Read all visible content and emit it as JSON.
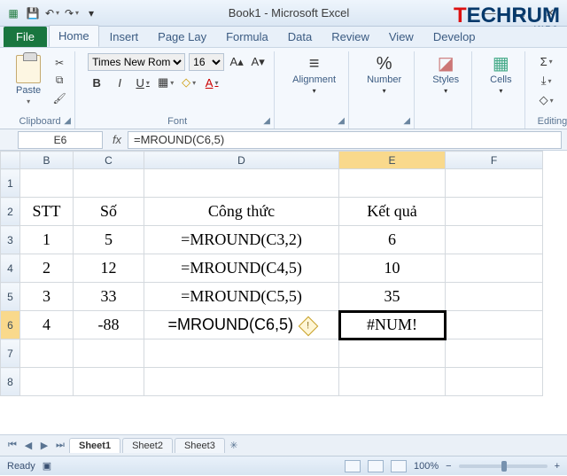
{
  "titlebar": {
    "title": "Book1 - Microsoft Excel"
  },
  "tabs": {
    "file": "File",
    "items": [
      "Home",
      "Insert",
      "Page Lay",
      "Formula",
      "Data",
      "Review",
      "View",
      "Develop"
    ],
    "active": "Home"
  },
  "ribbon": {
    "clipboard": {
      "paste": "Paste",
      "label": "Clipboard"
    },
    "font": {
      "name": "Times New Rom",
      "size": "16",
      "label": "Font",
      "bold": "B",
      "italic": "I",
      "underline": "U"
    },
    "alignment": {
      "label": "Alignment"
    },
    "number": {
      "label": "Number",
      "percent": "%",
      "comma": ","
    },
    "styles": {
      "label": "Styles"
    },
    "cells": {
      "label": "Cells"
    },
    "editing": {
      "label": "Editing",
      "sigma": "Σ"
    }
  },
  "namebox": {
    "ref": "E6"
  },
  "formulabar": {
    "fx": "fx",
    "value": "=MROUND(C6,5)"
  },
  "columns": [
    "B",
    "C",
    "D",
    "E",
    "F"
  ],
  "rows": [
    {
      "r": "1",
      "B": "",
      "C": "",
      "D": "",
      "E": "",
      "F": ""
    },
    {
      "r": "2",
      "B": "STT",
      "C": "Số",
      "D": "Công thức",
      "E": "Kết quả",
      "F": ""
    },
    {
      "r": "3",
      "B": "1",
      "C": "5",
      "D": "=MROUND(C3,2)",
      "E": "6",
      "F": ""
    },
    {
      "r": "4",
      "B": "2",
      "C": "12",
      "D": "=MROUND(C4,5)",
      "E": "10",
      "F": ""
    },
    {
      "r": "5",
      "B": "3",
      "C": "33",
      "D": "=MROUND(C5,5)",
      "E": "35",
      "F": ""
    },
    {
      "r": "6",
      "B": "4",
      "C": "-88",
      "D": "=MROUND(C6,5)",
      "E": "#NUM!",
      "F": ""
    },
    {
      "r": "7",
      "B": "",
      "C": "",
      "D": "",
      "E": "",
      "F": ""
    },
    {
      "r": "8",
      "B": "",
      "C": "",
      "D": "",
      "E": "",
      "F": ""
    }
  ],
  "active_cell": {
    "row": "6",
    "col": "E"
  },
  "sheets": {
    "items": [
      "Sheet1",
      "Sheet2",
      "Sheet3"
    ],
    "active": "Sheet1"
  },
  "status": {
    "ready": "Ready",
    "zoom": "100%",
    "minus": "−",
    "plus": "+"
  },
  "watermark": {
    "t": "T",
    "rest": "ECHRUM",
    "info": ".INFO"
  }
}
